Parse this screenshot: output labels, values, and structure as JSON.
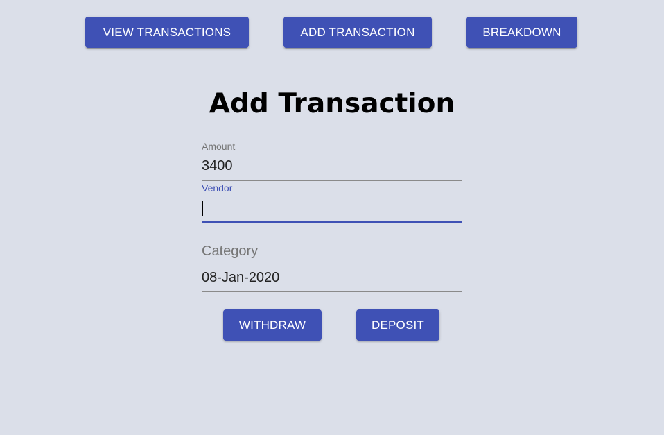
{
  "nav": {
    "view_transactions": "VIEW TRANSACTIONS",
    "add_transaction": "ADD TRANSACTION",
    "breakdown": "BREAKDOWN"
  },
  "page": {
    "title": "Add Transaction"
  },
  "form": {
    "amount": {
      "label": "Amount",
      "value": "3400"
    },
    "vendor": {
      "label": "Vendor",
      "value": ""
    },
    "category": {
      "placeholder": "Category",
      "value": ""
    },
    "date": {
      "value": "08-Jan-2020"
    },
    "withdraw_label": "WITHDRAW",
    "deposit_label": "DEPOSIT"
  },
  "colors": {
    "primary": "#3f51b5",
    "background": "#dbdfe9",
    "focused_label": "#3f51b5"
  }
}
